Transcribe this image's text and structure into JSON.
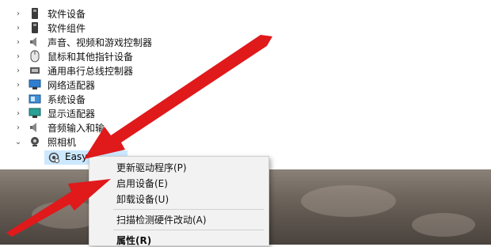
{
  "tree": {
    "items": [
      {
        "label": "软件设备",
        "icon": "software-device-icon"
      },
      {
        "label": "软件组件",
        "icon": "software-component-icon"
      },
      {
        "label": "声音、视频和游戏控制器",
        "icon": "speaker-icon"
      },
      {
        "label": "鼠标和其他指针设备",
        "icon": "mouse-icon"
      },
      {
        "label": "通用串行总线控制器",
        "icon": "usb-icon"
      },
      {
        "label": "网络适配器",
        "icon": "network-adapter-icon"
      },
      {
        "label": "系统设备",
        "icon": "system-device-icon"
      },
      {
        "label": "显示适配器",
        "icon": "display-adapter-icon"
      },
      {
        "label": "音频输入和输",
        "icon": "audio-io-icon"
      },
      {
        "label": "照相机",
        "icon": "camera-icon"
      }
    ],
    "child": {
      "label": "Easy C",
      "icon": "camera-device-icon"
    }
  },
  "context_menu": {
    "items": [
      {
        "label": "更新驱动程序(P)"
      },
      {
        "label": "启用设备(E)"
      },
      {
        "label": "卸载设备(U)"
      },
      {
        "label": "扫描检测硬件改动(A)"
      },
      {
        "label": "属性(R)"
      }
    ]
  },
  "colors": {
    "arrow": "#e0191b",
    "selection": "#cce8ff"
  }
}
